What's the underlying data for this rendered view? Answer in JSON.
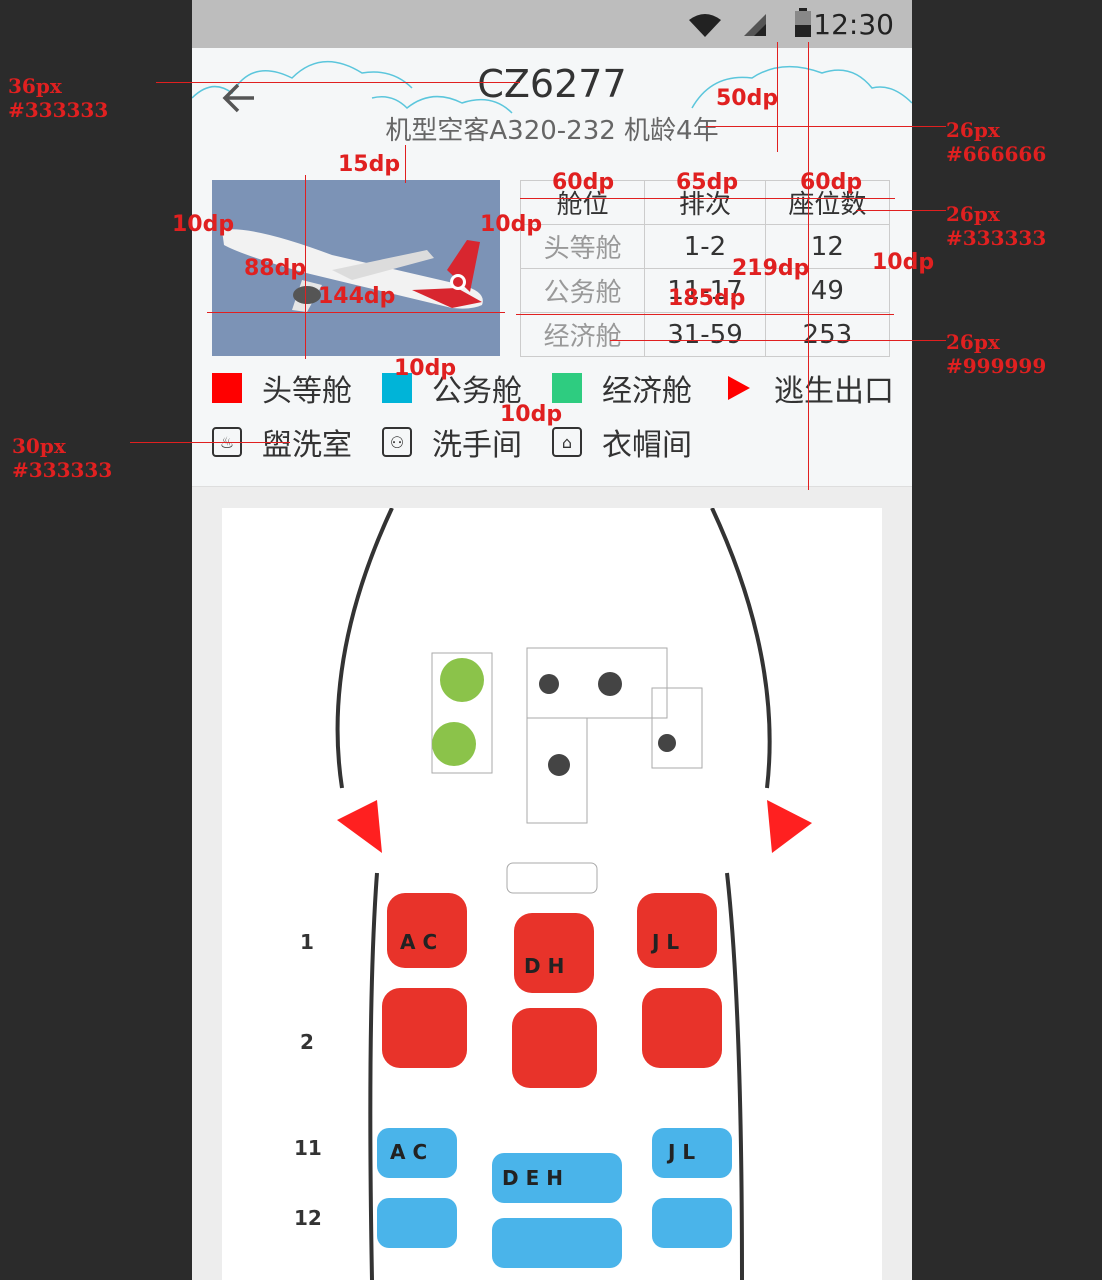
{
  "status_bar": {
    "time": "12:30"
  },
  "header": {
    "flight_no": "CZ6277",
    "aircraft_info": "机型空客A320-232  机龄4年"
  },
  "cabin_table": {
    "headers": [
      "舱位",
      "排次",
      "座位数"
    ],
    "rows": [
      {
        "cabin": "头等舱",
        "rows": "1-2",
        "seats": "12"
      },
      {
        "cabin": "公务舱",
        "rows": "11-17",
        "seats": "49"
      },
      {
        "cabin": "经济舱",
        "rows": "31-59",
        "seats": "253"
      }
    ]
  },
  "legend": {
    "first": {
      "label": "头等舱",
      "color": "#ff0000"
    },
    "business": {
      "label": "公务舱",
      "color": "#00b4d8"
    },
    "economy": {
      "label": "经济舱",
      "color": "#2ecc80"
    },
    "exit": {
      "label": "逃生出口",
      "color": "#ff0000"
    },
    "washroom": {
      "label": "盥洗室",
      "icon": "washbasin-icon"
    },
    "toilet": {
      "label": "洗手间",
      "icon": "toilet-icon"
    },
    "cloakroom": {
      "label": "衣帽间",
      "icon": "cloakroom-icon"
    }
  },
  "seatmap": {
    "row_labels": [
      "1",
      "2",
      "11",
      "12"
    ],
    "first_seats_left": "A C",
    "first_seats_mid": "D H",
    "first_seats_right": "J L",
    "business_left": "A C",
    "business_mid": "D E H",
    "business_right": "J L"
  },
  "annotations": {
    "title_spec": [
      "36px",
      "#333333"
    ],
    "subtitle_spec": [
      "26px",
      "#666666"
    ],
    "table_header_spec": [
      "26px",
      "#333333"
    ],
    "table_body_spec": [
      "26px",
      "#999999"
    ],
    "legend_spec": [
      "30px",
      "#333333"
    ],
    "dims": [
      "15dp",
      "50dp",
      "10dp",
      "10dp",
      "88dp",
      "144dp",
      "60dp",
      "65dp",
      "60dp",
      "219dp",
      "10dp",
      "185dp",
      "10dp",
      "10dp"
    ]
  }
}
